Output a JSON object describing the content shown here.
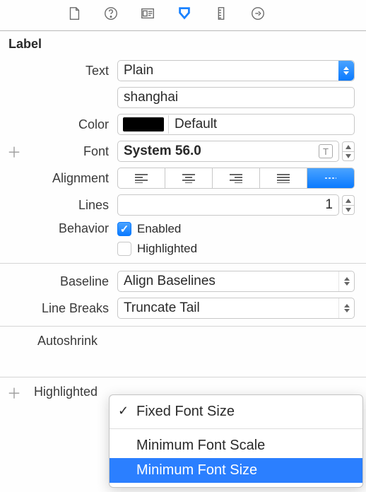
{
  "section": {
    "title": "Label"
  },
  "rows": {
    "text_label": "Text",
    "text_type": "Plain",
    "text_value": "shanghai",
    "color_label": "Color",
    "color_value": "Default",
    "color_swatch": "#000000",
    "font_label": "Font",
    "font_value": "System 56.0",
    "alignment_label": "Alignment",
    "lines_label": "Lines",
    "lines_value": "1",
    "behavior_label": "Behavior",
    "behavior_enabled": "Enabled",
    "behavior_highlighted": "Highlighted",
    "baseline_label": "Baseline",
    "baseline_value": "Align Baselines",
    "linebreaks_label": "Line Breaks",
    "linebreaks_value": "Truncate Tail",
    "autoshrink_label": "Autoshrink",
    "highlighted_label": "Highlighted"
  },
  "behavior": {
    "enabled_checked": true,
    "highlighted_checked": false
  },
  "alignment": {
    "selected_index": 4
  },
  "autoshrink_menu": {
    "items": [
      "Fixed Font Size",
      "Minimum Font Scale",
      "Minimum Font Size"
    ],
    "checked_index": 0,
    "selected_index": 2
  },
  "toolbar_icons": [
    "file-icon",
    "help-icon",
    "identity-icon",
    "download-icon",
    "size-icon",
    "connections-icon"
  ]
}
